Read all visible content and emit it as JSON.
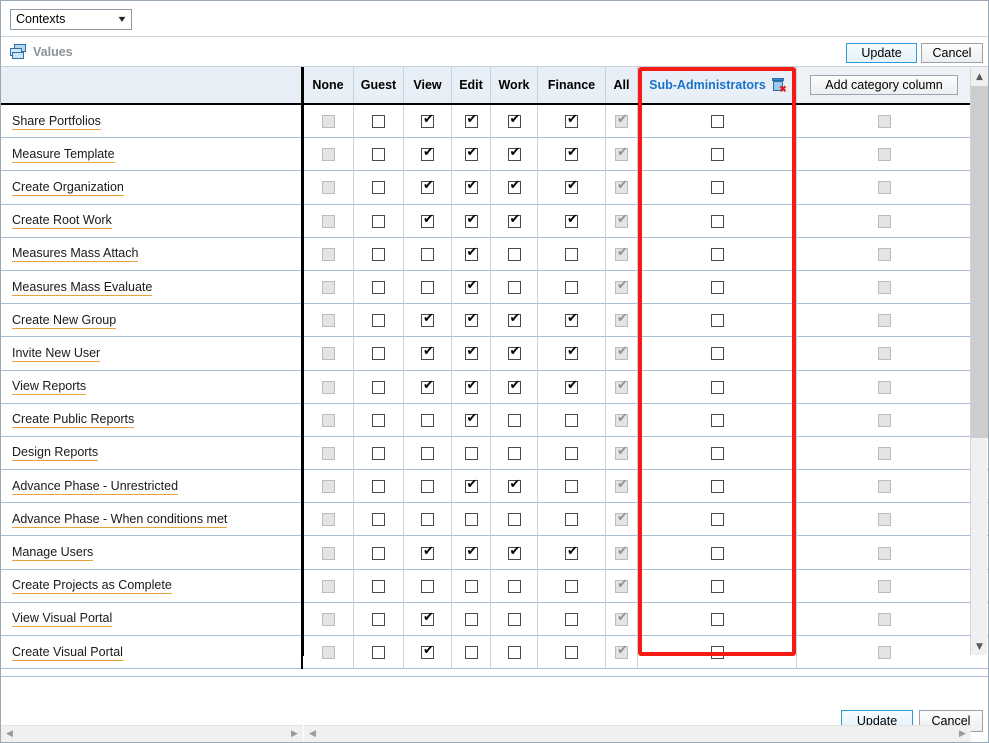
{
  "topbar": {
    "context_select": {
      "value": "Contexts",
      "chevron": "chevron-down-icon"
    }
  },
  "values_bar": {
    "label": "Values",
    "icon": "stacked-windows-icon",
    "update_label": "Update",
    "cancel_label": "Cancel"
  },
  "grid": {
    "add_category_column_label": "Add category column",
    "subadmin_delete_icon": "delete-column-icon",
    "columns": [
      {
        "label": "",
        "type": "rowlabel"
      },
      {
        "label": "None",
        "type": "checkbox"
      },
      {
        "label": "Guest",
        "type": "checkbox"
      },
      {
        "label": "View",
        "type": "checkbox"
      },
      {
        "label": "Edit",
        "type": "checkbox"
      },
      {
        "label": "Work",
        "type": "checkbox"
      },
      {
        "label": "Finance",
        "type": "checkbox"
      },
      {
        "label": "All",
        "type": "checkbox"
      },
      {
        "label": "Sub-Administrators",
        "type": "checkbox"
      },
      {
        "label": "",
        "type": "checkbox"
      }
    ],
    "rows": [
      {
        "label": "Share Portfolios",
        "cells": [
          "none-off",
          "off",
          "on",
          "on",
          "on",
          "on",
          "all-on",
          "off",
          "dis-off"
        ]
      },
      {
        "label": "Measure Template",
        "cells": [
          "none-off",
          "off",
          "on",
          "on",
          "on",
          "on",
          "all-on",
          "off",
          "dis-off"
        ]
      },
      {
        "label": "Create Organization",
        "cells": [
          "none-off",
          "off",
          "on",
          "on",
          "on",
          "on",
          "all-on",
          "off",
          "dis-off"
        ]
      },
      {
        "label": "Create Root Work",
        "cells": [
          "none-off",
          "off",
          "on",
          "on",
          "on",
          "on",
          "all-on",
          "off",
          "dis-off"
        ]
      },
      {
        "label": "Measures Mass Attach",
        "cells": [
          "none-off",
          "off",
          "off",
          "on",
          "off",
          "off",
          "all-on",
          "off",
          "dis-off"
        ]
      },
      {
        "label": "Measures Mass Evaluate",
        "cells": [
          "none-off",
          "off",
          "off",
          "on",
          "off",
          "off",
          "all-on",
          "off",
          "dis-off"
        ]
      },
      {
        "label": "Create New Group",
        "cells": [
          "none-off",
          "off",
          "on",
          "on",
          "on",
          "on",
          "all-on",
          "off",
          "dis-off"
        ]
      },
      {
        "label": "Invite New User",
        "cells": [
          "none-off",
          "off",
          "on",
          "on",
          "on",
          "on",
          "all-on",
          "off",
          "dis-off"
        ]
      },
      {
        "label": "View Reports",
        "cells": [
          "none-off",
          "off",
          "on",
          "on",
          "on",
          "on",
          "all-on",
          "off",
          "dis-off"
        ]
      },
      {
        "label": "Create Public Reports",
        "cells": [
          "none-off",
          "off",
          "off",
          "on",
          "off",
          "off",
          "all-on",
          "off",
          "dis-off"
        ]
      },
      {
        "label": "Design Reports",
        "cells": [
          "none-off",
          "off",
          "off",
          "off",
          "off",
          "off",
          "all-on",
          "off",
          "dis-off"
        ]
      },
      {
        "label": "Advance Phase - Unrestricted",
        "cells": [
          "none-off",
          "off",
          "off",
          "on",
          "on",
          "off",
          "all-on",
          "off",
          "dis-off"
        ]
      },
      {
        "label": "Advance Phase - When conditions met",
        "cells": [
          "none-off",
          "off",
          "off",
          "off",
          "off",
          "off",
          "all-on",
          "off",
          "dis-off"
        ]
      },
      {
        "label": "Manage Users",
        "cells": [
          "none-off",
          "off",
          "on",
          "on",
          "on",
          "on",
          "all-on",
          "off",
          "dis-off"
        ]
      },
      {
        "label": "Create Projects as Complete",
        "cells": [
          "none-off",
          "off",
          "off",
          "off",
          "off",
          "off",
          "all-on",
          "off",
          "dis-off"
        ]
      },
      {
        "label": "View Visual Portal",
        "cells": [
          "none-off",
          "off",
          "on",
          "off",
          "off",
          "off",
          "all-on",
          "off",
          "dis-off"
        ]
      },
      {
        "label": "Create Visual Portal",
        "cells": [
          "none-off",
          "off",
          "on",
          "off",
          "off",
          "off",
          "all-on",
          "off",
          "dis-off"
        ]
      }
    ]
  },
  "scrollbars": {
    "vertical_up": "chevron-up-icon",
    "vertical_down": "chevron-down-icon",
    "horizontal_left": "chevron-left-icon",
    "horizontal_right": "chevron-right-icon"
  },
  "footer": {
    "update_label": "Update",
    "cancel_label": "Cancel"
  },
  "colors": {
    "header_bg": "#e8eff7",
    "subadmin_text": "#1a73c8",
    "highlight_box": "#f51b12",
    "row_underline": "#e8a33d",
    "primary_border": "#2e9ad6"
  }
}
